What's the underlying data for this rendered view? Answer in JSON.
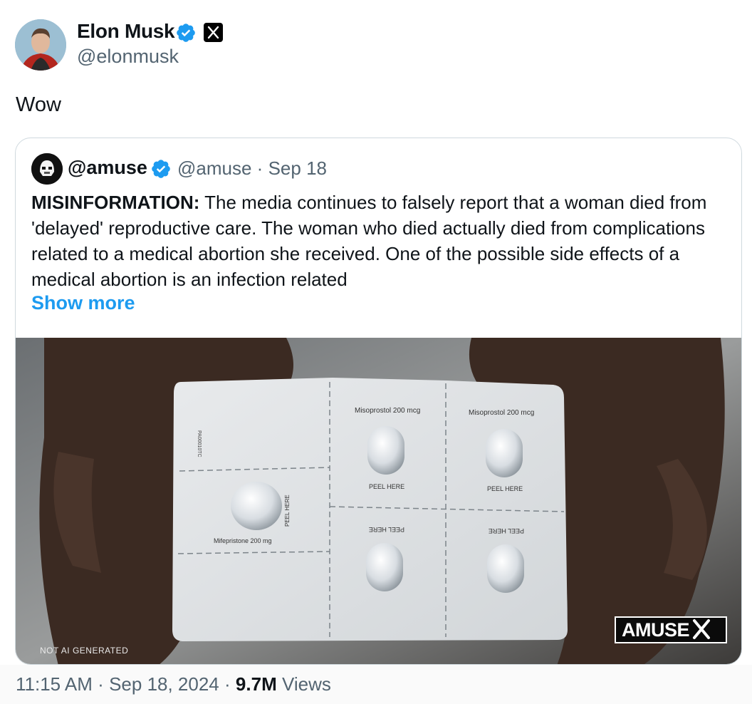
{
  "tweet": {
    "author_name": "Elon Musk",
    "author_handle": "@elonmusk",
    "text": "Wow",
    "time": "11:15 AM",
    "date": "Sep 18, 2024",
    "views_count": "9.7M",
    "views_label": "Views",
    "separator": "·"
  },
  "quoted": {
    "author_name": "@amuse",
    "author_handle": "@amuse",
    "date": "Sep 18",
    "separator": "·",
    "lead": "MISINFORMATION:",
    "body": "The media continues to falsely report that a woman died from 'delayed' reproductive care. The woman who died actually died from complications related to a medical abortion she received. One of the possible side effects of a medical abortion is an infection related",
    "show_more": "Show more",
    "media": {
      "watermark": "NOT AI GENERATED",
      "logo": "AMUSE",
      "pack_labels": {
        "top": "Misoprostol 200 mcg",
        "peel": "PEEL HERE",
        "left": "Mifepristone 200 mg",
        "side_code": "PA00010TC"
      }
    }
  },
  "colors": {
    "verified": "#1d9bf0",
    "link": "#1d9bf0",
    "secondary_text": "#536471",
    "primary_text": "#0f1419",
    "border": "#cfd9de"
  },
  "icons": [
    "verified-badge-icon",
    "x-logo-icon"
  ]
}
